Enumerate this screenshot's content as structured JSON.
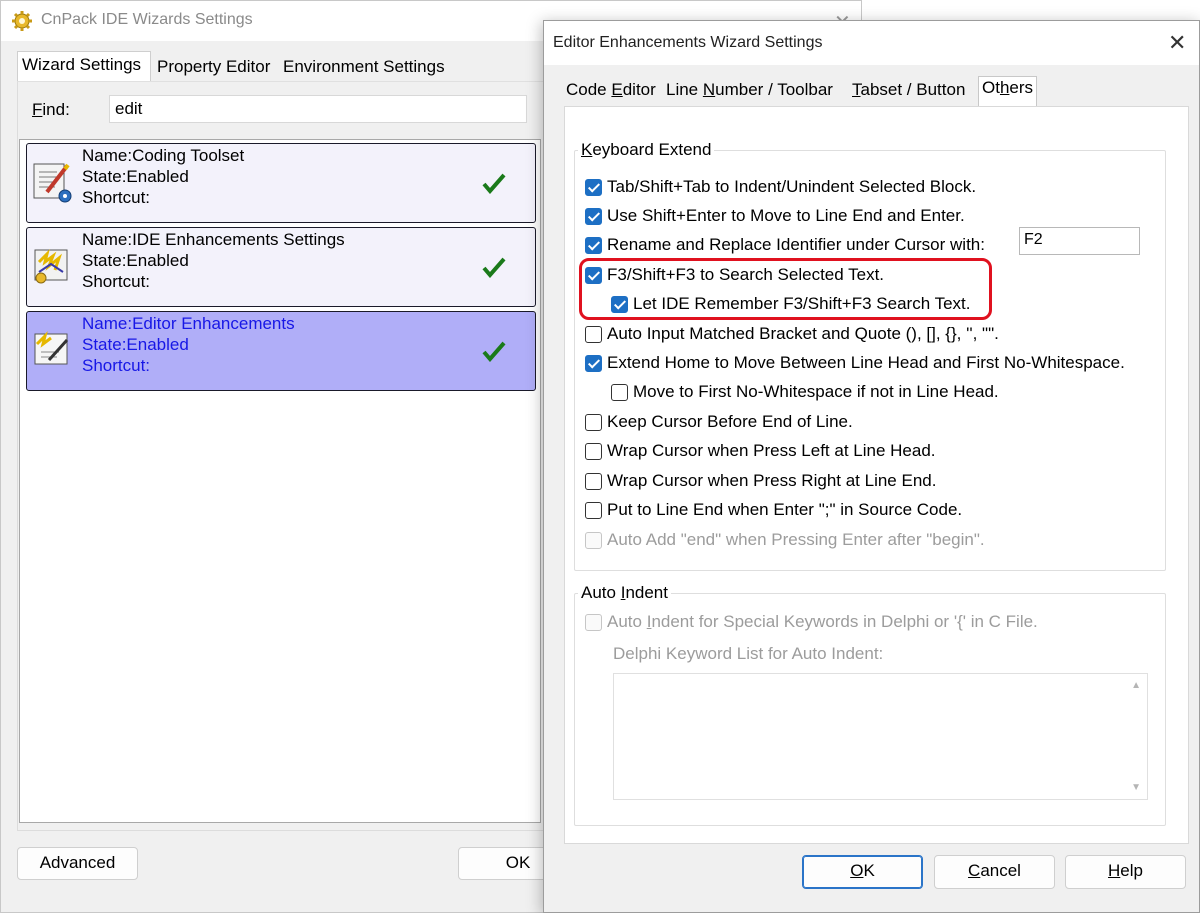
{
  "main_window": {
    "title": "CnPack IDE Wizards Settings",
    "tabs": [
      "Wizard Settings",
      "Property Editor",
      "Environment Settings"
    ],
    "find": {
      "label_before": "",
      "label_accel": "F",
      "label_after": "ind:",
      "value": "edit"
    },
    "wizards": [
      {
        "name": "Name:Coding Toolset",
        "state": "State:Enabled",
        "shortcut": "Shortcut:",
        "icon": "coding-toolset-icon"
      },
      {
        "name": "Name:IDE Enhancements Settings",
        "state": "State:Enabled",
        "shortcut": "Shortcut:",
        "icon": "ide-enhancements-icon"
      },
      {
        "name": "Name:Editor Enhancements",
        "state": "State:Enabled",
        "shortcut": "Shortcut:",
        "icon": "editor-enhancements-icon"
      }
    ],
    "buttons": {
      "advanced": "Advanced",
      "ok": "OK"
    }
  },
  "dialog": {
    "title": "Editor Enhancements Wizard Settings",
    "tabs": [
      {
        "pre": "Code ",
        "accel": "E",
        "post": "ditor"
      },
      {
        "pre": "Line ",
        "accel": "N",
        "post": "umber / Toolbar"
      },
      {
        "pre": "",
        "accel": "T",
        "post": "abset / Button"
      },
      {
        "pre": "Ot",
        "accel": "h",
        "post": "ers"
      }
    ],
    "keyboard_extend": {
      "title_accel": "K",
      "title_rest": "eyboard Extend",
      "options": [
        {
          "label": "Tab/Shift+Tab to Indent/Unindent Selected Block.",
          "checked": true,
          "enabled": true
        },
        {
          "label": "Use Shift+Enter to Move to Line End and Enter.",
          "checked": true,
          "enabled": true
        },
        {
          "label": "Rename and Replace Identifier under Cursor with:",
          "checked": true,
          "enabled": true
        },
        {
          "label": "F3/Shift+F3 to Search Selected Text.",
          "checked": true,
          "enabled": true
        },
        {
          "label": "Let IDE Remember F3/Shift+F3 Search Text.",
          "checked": true,
          "enabled": true
        },
        {
          "label": "Auto Input Matched Bracket and Quote (), [], {}, '', \"\".",
          "checked": false,
          "enabled": true
        },
        {
          "label": "Extend Home to Move Between Line Head and First No-Whitespace.",
          "checked": true,
          "enabled": true
        },
        {
          "label": "Move to First No-Whitespace if not in Line Head.",
          "checked": false,
          "enabled": true
        },
        {
          "label": "Keep Cursor Before End of Line.",
          "checked": false,
          "enabled": true
        },
        {
          "label": "Wrap Cursor when Press Left at Line Head.",
          "checked": false,
          "enabled": true
        },
        {
          "label": "Wrap Cursor when Press Right at Line End.",
          "checked": false,
          "enabled": true
        },
        {
          "label": "Put to Line End when Enter \";\" in Source Code.",
          "checked": false,
          "enabled": true
        },
        {
          "label": "Auto Add \"end\" when Pressing Enter after \"begin\".",
          "checked": false,
          "enabled": false
        }
      ],
      "rename_shortcut_value": "F2"
    },
    "auto_indent": {
      "title_pre": "Auto ",
      "title_accel": "I",
      "title_post": "ndent",
      "option_pre": "Auto ",
      "option_accel": "I",
      "option_post": "ndent for Special Keywords in Delphi or '{' in C File.",
      "option_checked": false,
      "option_enabled": false,
      "list_label": "Delphi Keyword List for Auto Indent:"
    },
    "buttons": {
      "ok": {
        "pre": "",
        "accel": "O",
        "post": "K"
      },
      "cancel": {
        "pre": "",
        "accel": "C",
        "post": "ancel"
      },
      "help": {
        "pre": "",
        "accel": "H",
        "post": "elp"
      }
    }
  },
  "colors": {
    "selected_item_bg": "#b0aef8",
    "selected_item_text": "#1717e6",
    "checkbox_on": "#1d6fc4",
    "highlight_border": "#e0111f"
  }
}
